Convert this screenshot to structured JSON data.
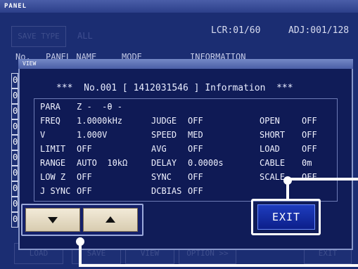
{
  "window": {
    "title": "PANEL"
  },
  "toolbar": {
    "save_type_label": "SAVE TYPE",
    "all_label": "ALL"
  },
  "status": {
    "lcr": "LCR:01/60",
    "adj": "ADJ:001/128"
  },
  "list_header": {
    "no": "No.",
    "panel_name": "PANEL NAME",
    "mode": "MODE",
    "information": "INFORMATION"
  },
  "row_stub_labels": [
    "0",
    "0",
    "0",
    "0",
    "0",
    "0",
    "0",
    "0",
    "0",
    "0"
  ],
  "view_dialog": {
    "title": "VIEW",
    "info_line": "***  No.001 [ 1412031546 ] Information  ***",
    "params": [
      {
        "label": "PARA",
        "value": "Z -  -θ -"
      },
      {
        "label": "FREQ",
        "value": "1.0000kHz"
      },
      {
        "label": "V",
        "value": "1.000V"
      },
      {
        "label": "LIMIT",
        "value": "OFF"
      },
      {
        "label": "RANGE",
        "value": "AUTO  10kΩ"
      },
      {
        "label": "LOW Z",
        "value": "OFF"
      },
      {
        "label": "J SYNC",
        "value": "OFF"
      }
    ],
    "params_mid": [
      {
        "label": "JUDGE",
        "value": "OFF"
      },
      {
        "label": "SPEED",
        "value": "MED"
      },
      {
        "label": "AVG",
        "value": "OFF"
      },
      {
        "label": "DELAY",
        "value": "0.0000s"
      },
      {
        "label": "SYNC",
        "value": "OFF"
      },
      {
        "label": "DCBIAS",
        "value": "OFF"
      }
    ],
    "params_right": [
      {
        "label": "OPEN",
        "value": "OFF"
      },
      {
        "label": "SHORT",
        "value": "OFF"
      },
      {
        "label": "LOAD",
        "value": "OFF"
      },
      {
        "label": "CABLE",
        "value": "0m"
      },
      {
        "label": "SCALE",
        "value": "OFF"
      }
    ],
    "exit_label": "EXIT"
  },
  "bottom_bar": {
    "load_label": "LOAD",
    "save_label": "SAVE",
    "view_label": "VIEW",
    "option_label": "OPTION >>",
    "exit_label": "EXIT"
  },
  "colors": {
    "bg": "#1b2d72",
    "exit_button": "#1530a8",
    "nav_button": "#e8dfc6",
    "callout": "#ffffff"
  }
}
